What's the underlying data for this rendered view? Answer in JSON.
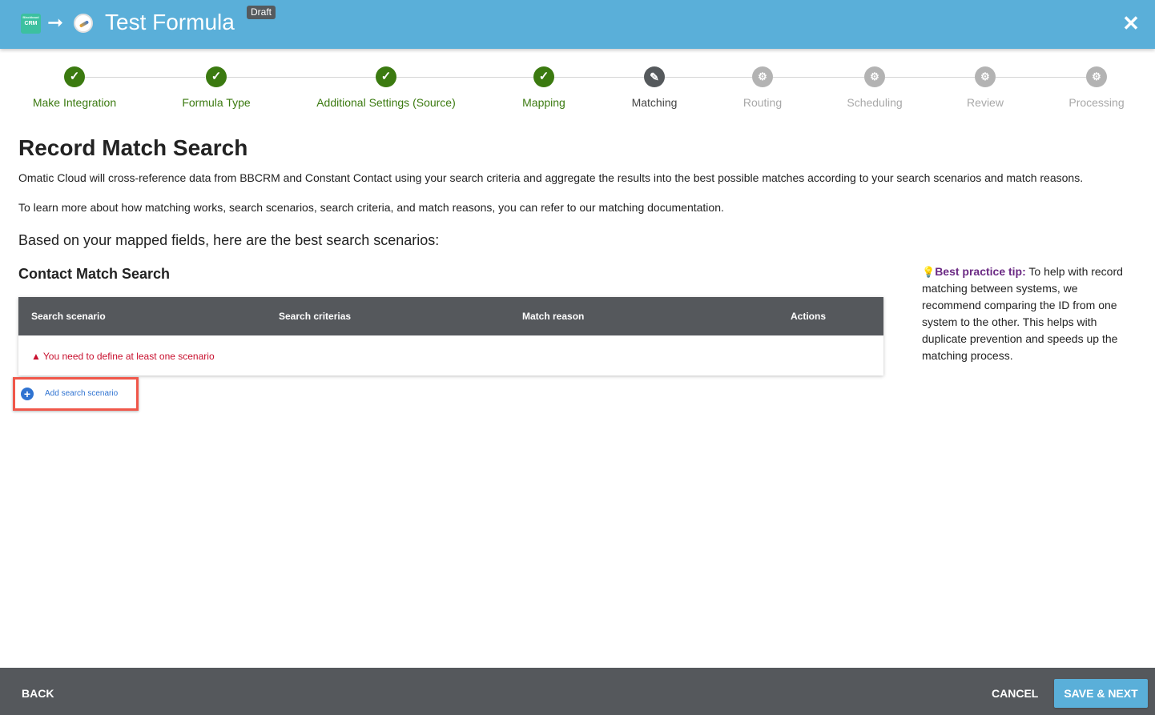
{
  "header": {
    "source_logo_text": "CRM",
    "source_logo_small": "Blackbaud",
    "title": "Test Formula",
    "badge": "Draft",
    "close_glyph": "✕"
  },
  "steps": [
    {
      "label": "Make Integration",
      "state": "done"
    },
    {
      "label": "Formula Type",
      "state": "done"
    },
    {
      "label": "Additional Settings (Source)",
      "state": "done"
    },
    {
      "label": "Mapping",
      "state": "done"
    },
    {
      "label": "Matching",
      "state": "current"
    },
    {
      "label": "Routing",
      "state": "todo"
    },
    {
      "label": "Scheduling",
      "state": "todo"
    },
    {
      "label": "Review",
      "state": "todo"
    },
    {
      "label": "Processing",
      "state": "todo"
    }
  ],
  "content": {
    "page_title": "Record Match Search",
    "intro": "Omatic Cloud will cross-reference data from BBCRM and Constant Contact using your search criteria and aggregate the results into the best possible matches according to your search scenarios and match reasons.",
    "learn_more": "To learn more about how matching works, search scenarios, search criteria, and match reasons, you can refer to our matching documentation.",
    "subhead": "Based on your mapped fields, here are the best search scenarios:",
    "section_title": "Contact Match Search"
  },
  "table": {
    "columns": [
      "Search scenario",
      "Search criterias",
      "Match reason",
      "Actions"
    ],
    "error": "You need to define at least one scenario"
  },
  "add_button": {
    "label": "Add search scenario"
  },
  "tip": {
    "label": "Best practice tip:",
    "text": " To help with record matching between systems, we recommend comparing the ID from one system to the other. This helps with duplicate prevention and speeds up the matching process."
  },
  "footer": {
    "back": "BACK",
    "cancel": "CANCEL",
    "save": "SAVE & NEXT"
  },
  "colors": {
    "header": "#5aafd9",
    "done": "#3b7a10",
    "error": "#c8102e",
    "tip": "#6b2a84",
    "footer": "#55585c"
  }
}
